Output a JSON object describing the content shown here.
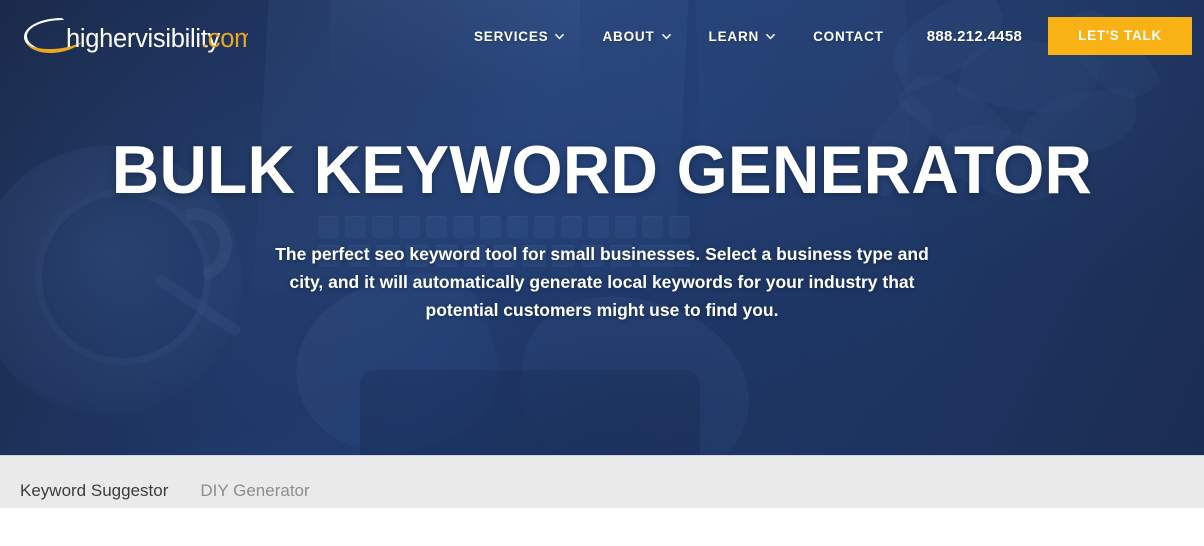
{
  "header": {
    "logo": {
      "name": "highervisibility-logo",
      "text_main": "highervisibility",
      "text_tld": ".com"
    },
    "nav": [
      {
        "label": "SERVICES",
        "has_dropdown": true,
        "icon": "chevron-down-icon"
      },
      {
        "label": "ABOUT",
        "has_dropdown": true,
        "icon": "chevron-down-icon"
      },
      {
        "label": "LEARN",
        "has_dropdown": true,
        "icon": "chevron-down-icon"
      },
      {
        "label": "CONTACT",
        "has_dropdown": false,
        "icon": ""
      }
    ],
    "phone": "888.212.4458",
    "cta_label": "LET'S TALK"
  },
  "hero": {
    "title": "BULK KEYWORD GENERATOR",
    "subtitle": "The perfect seo keyword tool for small businesses. Select a business type and city, and it will automatically generate local keywords for your industry that potential customers might use to find you."
  },
  "tabs": [
    {
      "label": "Keyword Suggestor",
      "active": true
    },
    {
      "label": "DIY Generator",
      "active": false
    }
  ],
  "colors": {
    "brand_navy": "#24437d",
    "hero_dark": "#1d2c4c",
    "accent_yellow": "#f8b215",
    "tab_underline": "#f4b330",
    "tabbar_bg": "#eaeaea",
    "tab_active_text": "#3c3c3c",
    "tab_inactive_text": "#8d8d8d",
    "logo_gold": "#e8a81f",
    "text_white": "#ffffff"
  }
}
